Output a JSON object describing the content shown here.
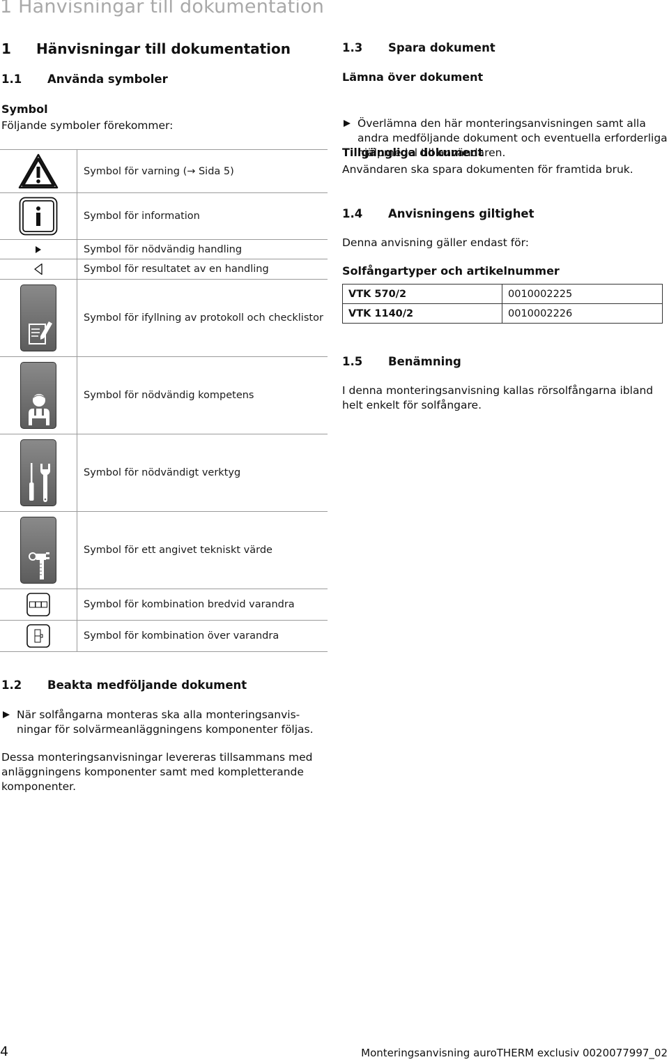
{
  "running_head": "1 Hänvisningar till dokumentation",
  "chapter": {
    "number": "1",
    "title": "Hänvisningar till dokumentation"
  },
  "section_1_1": {
    "number": "1.1",
    "title": "Använda symboler",
    "subheading": "Symbol",
    "intro": "Följande symboler förekommer:",
    "symbols": [
      {
        "icon": "warning-triangle-icon",
        "label": "Symbol för varning (→ Sida 5)"
      },
      {
        "icon": "information-icon",
        "label": "Symbol för information"
      },
      {
        "icon": "action-arrow-icon",
        "label": "Symbol för nödvändig handling"
      },
      {
        "icon": "result-arrow-icon",
        "label": "Symbol för resultatet av en handling"
      },
      {
        "icon": "checklist-pencil-icon",
        "label": "Symbol för ifyllning av protokoll och checklistor"
      },
      {
        "icon": "technician-icon",
        "label": "Symbol för nödvändig kompetens"
      },
      {
        "icon": "tools-icon",
        "label": "Symbol för nödvändigt verktyg"
      },
      {
        "icon": "caliper-icon",
        "label": "Symbol för ett angivet tekniskt värde"
      },
      {
        "icon": "side-by-side-icon",
        "label": "Symbol för kombination bredvid varandra"
      },
      {
        "icon": "stacked-icon",
        "label": "Symbol för kombination över varandra"
      }
    ]
  },
  "section_1_2": {
    "number": "1.2",
    "title": "Beakta medföljande dokument",
    "bullet": "När solfångarna monteras ska alla monteringsanvis- ningar för solvärmeanläggningens komponenter följas.",
    "bullet_line1": "När solfångarna monteras ska alla monteringsanvis-",
    "bullet_line2": "ningar för solvärmeanläggningens komponenter följas.",
    "paragraph_line1": "Dessa monteringsanvisningar levereras tillsammans med",
    "paragraph_line2": "anläggningens komponenter samt med kompletterande",
    "paragraph_line3": "komponenter."
  },
  "section_1_3": {
    "number": "1.3",
    "title": "Spara dokument",
    "sub1": "Lämna över dokument",
    "bullet_line1": "Överlämna den här monteringsanvisningen samt alla",
    "bullet_line2": "andra medföljande dokument och eventuella erforderliga",
    "bullet_line3": "hjälpmedel till användaren.",
    "sub2": "Tillgängliga dokument",
    "sub2_text": "Användaren ska spara dokumenten för framtida bruk."
  },
  "section_1_4": {
    "number": "1.4",
    "title": "Anvisningens giltighet",
    "intro": "Denna anvisning gäller endast för:",
    "table_heading": "Solfångartyper och artikelnummer",
    "rows": [
      {
        "type": "VTK 570/2",
        "article": "0010002225"
      },
      {
        "type": "VTK 1140/2",
        "article": "0010002226"
      }
    ]
  },
  "section_1_5": {
    "number": "1.5",
    "title": "Benämning",
    "line1": "I denna monteringsanvisning kallas rörsolfångarna ibland",
    "line2": "helt enkelt för solfångare."
  },
  "footer": {
    "page_number": "4",
    "doc_title": "Monteringsanvisning auroTHERM exclusiv 0020077997_02"
  }
}
